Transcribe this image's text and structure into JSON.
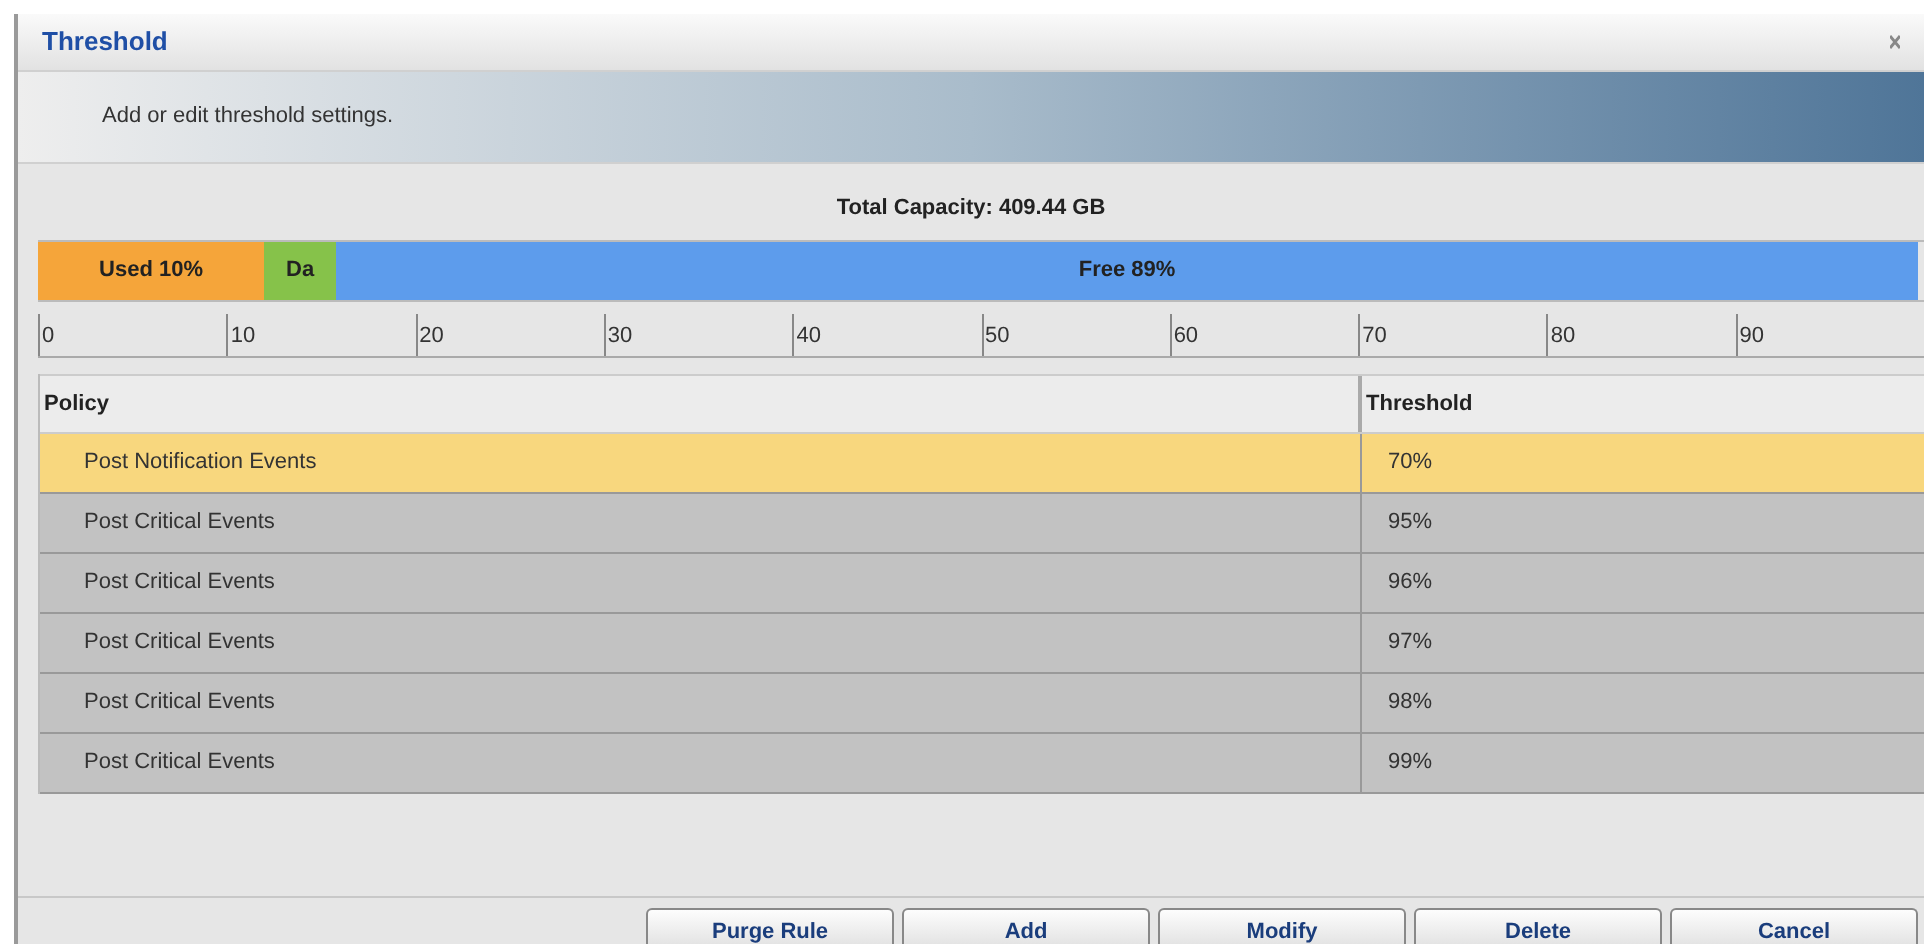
{
  "window": {
    "title": "Threshold"
  },
  "description": "Add or edit threshold settings.",
  "capacity": "Total Capacity: 409.44 GB",
  "usage_bar": [
    {
      "kind": "used",
      "label": "Used 10%"
    },
    {
      "kind": "data",
      "label": "Da"
    },
    {
      "kind": "free",
      "label": "Free 89%"
    }
  ],
  "scale": [
    "0",
    "10",
    "20",
    "30",
    "40",
    "50",
    "60",
    "70",
    "80",
    "90"
  ],
  "table": {
    "columns": [
      "Policy",
      "Threshold"
    ],
    "rows": [
      {
        "policy": "Post Notification Events",
        "threshold": "70%",
        "selected": true
      },
      {
        "policy": "Post Critical Events",
        "threshold": "95%",
        "selected": false
      },
      {
        "policy": "Post Critical Events",
        "threshold": "96%",
        "selected": false
      },
      {
        "policy": "Post Critical Events",
        "threshold": "97%",
        "selected": false
      },
      {
        "policy": "Post Critical Events",
        "threshold": "98%",
        "selected": false
      },
      {
        "policy": "Post Critical Events",
        "threshold": "99%",
        "selected": false
      }
    ]
  },
  "buttons": [
    "Purge Rule",
    "Add",
    "Modify",
    "Delete",
    "Cancel"
  ]
}
